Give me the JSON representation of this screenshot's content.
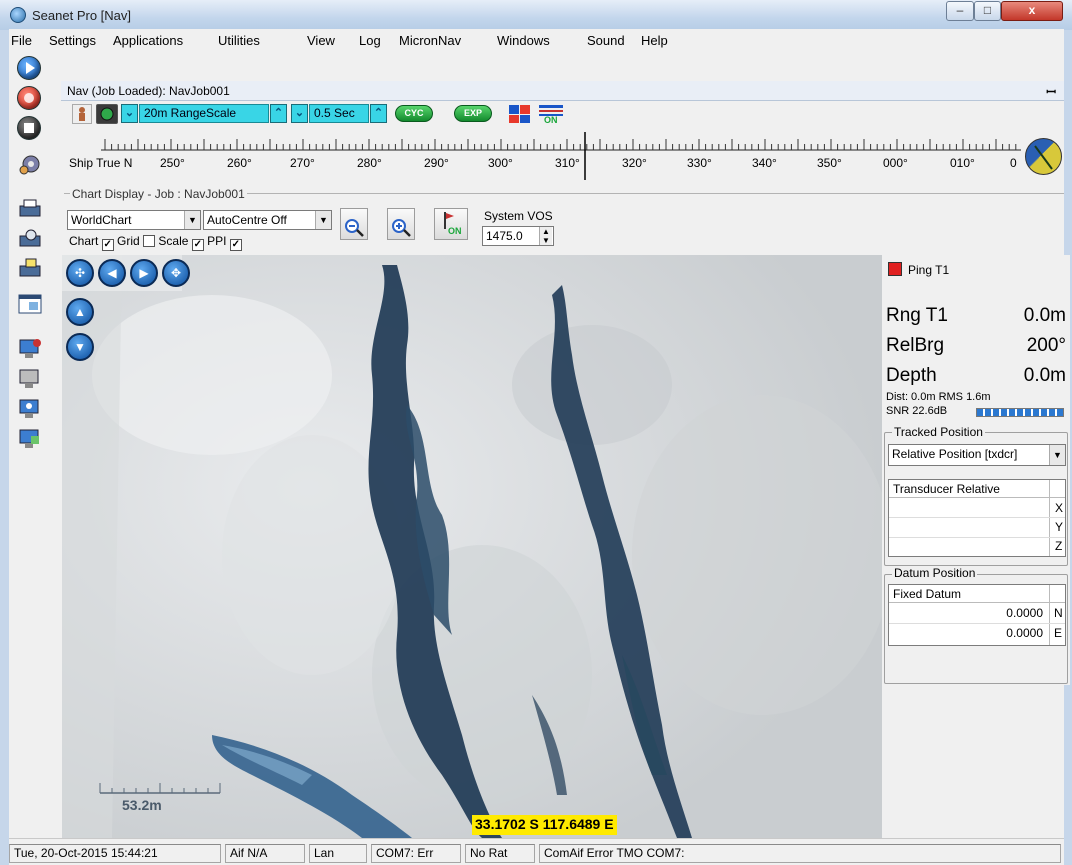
{
  "window": {
    "title": "Seanet Pro [Nav]",
    "min_label": "–",
    "max_label": "□",
    "close_label": "x",
    "app_icon": "globe-icon"
  },
  "menu": [
    "File",
    "Settings",
    "Applications",
    "Utilities",
    "View",
    "Log",
    "MicronNav",
    "Windows",
    "Sound",
    "Help"
  ],
  "nav": {
    "title": "Nav (Job Loaded): NavJob001",
    "pin": "ꟷ",
    "range_scale": "20m RangeScale",
    "interval": "0.5 Sec",
    "cyc": "CYC",
    "exp": "EXP",
    "on_label": "ON"
  },
  "compass": {
    "label": "Ship True N",
    "ticks": [
      "250°",
      "260°",
      "270°",
      "280°",
      "290°",
      "300°",
      "310°",
      "320°",
      "330°",
      "340°",
      "350°",
      "000°",
      "010°",
      "0"
    ]
  },
  "chart_display": {
    "group_label": "Chart Display - Job : NavJob001",
    "chart_select": "WorldChart",
    "autocentre_select": "AutoCentre Off",
    "chart_chk": "Chart",
    "grid_chk": "Grid",
    "scale_chk": "Scale",
    "ppi_chk": "PPI",
    "checked_mark": "✓",
    "flag_on": "ON",
    "vos_label": "System VOS",
    "vos_value": "1475.0"
  },
  "map": {
    "scale_label": "53.2m",
    "coordinate": "33.1702 S 117.6489 E",
    "colors": {
      "ice": "#d8dbde",
      "water": "#1f3a55"
    }
  },
  "ping": {
    "label": "Ping T1",
    "rng_label": "Rng T1",
    "rng_value": "0.0m",
    "relbrg_label": "RelBrg",
    "relbrg_value": "200°",
    "depth_label": "Depth",
    "depth_value": "0.0m",
    "dist": "Dist: 0.0m RMS 1.6m",
    "snr": "SNR 22.6dB",
    "snr_level": 1.0
  },
  "tracked": {
    "title": "Tracked Position",
    "select": "Relative Position [txdcr]",
    "table_header": "Transducer Relative",
    "axes": [
      "X",
      "Y",
      "Z"
    ]
  },
  "datum": {
    "title": "Datum Position",
    "table_header": "Fixed Datum",
    "rows": [
      {
        "value": "0.0000",
        "axis": "N"
      },
      {
        "value": "0.0000",
        "axis": "E"
      }
    ]
  },
  "status": {
    "datetime": "Tue, 20-Oct-2015 15:44:21",
    "aif": "Aif N/A",
    "lan": "Lan",
    "com": "COM7: Err",
    "rat": "No Rat",
    "error": "ComAif Error TMO COM7:"
  }
}
